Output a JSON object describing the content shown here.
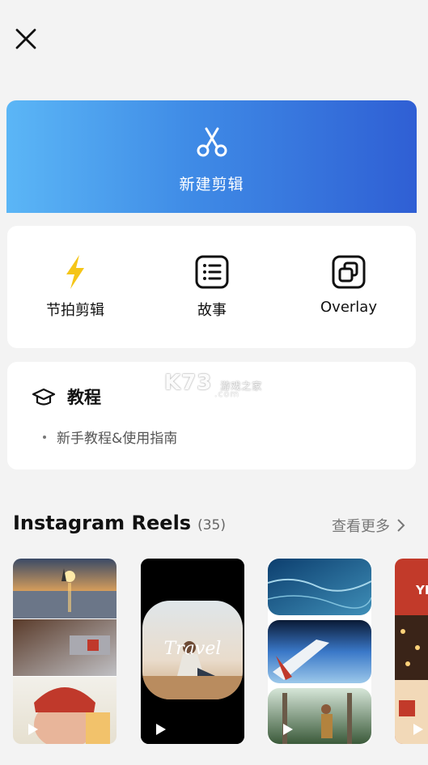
{
  "header": {
    "close_icon": "close-icon"
  },
  "new_edit": {
    "label": "新建剪辑",
    "icon": "scissors-icon",
    "gradient": [
      "#5bb6f6",
      "#2f5fd4"
    ]
  },
  "quick_actions": [
    {
      "label": "节拍剪辑",
      "icon": "lightning-icon",
      "color": "#f5c518"
    },
    {
      "label": "故事",
      "icon": "list-icon"
    },
    {
      "label": "Overlay",
      "icon": "overlay-icon"
    }
  ],
  "tutorial": {
    "title": "教程",
    "icon": "graduation-cap-icon",
    "link": "新手教程&使用指南"
  },
  "watermark": {
    "main": "K73",
    "sub": "游戏之家",
    "domain": ".com"
  },
  "reels_section": {
    "title": "Instagram Reels",
    "count": "(35)",
    "see_more": "查看更多"
  },
  "reels": [
    {
      "name": "sunset-beach-collage"
    },
    {
      "name": "travel-template",
      "overlay_text": "Travel"
    },
    {
      "name": "ocean-flight-collage"
    },
    {
      "name": "christmas-template",
      "overlay_text": "YE"
    }
  ]
}
